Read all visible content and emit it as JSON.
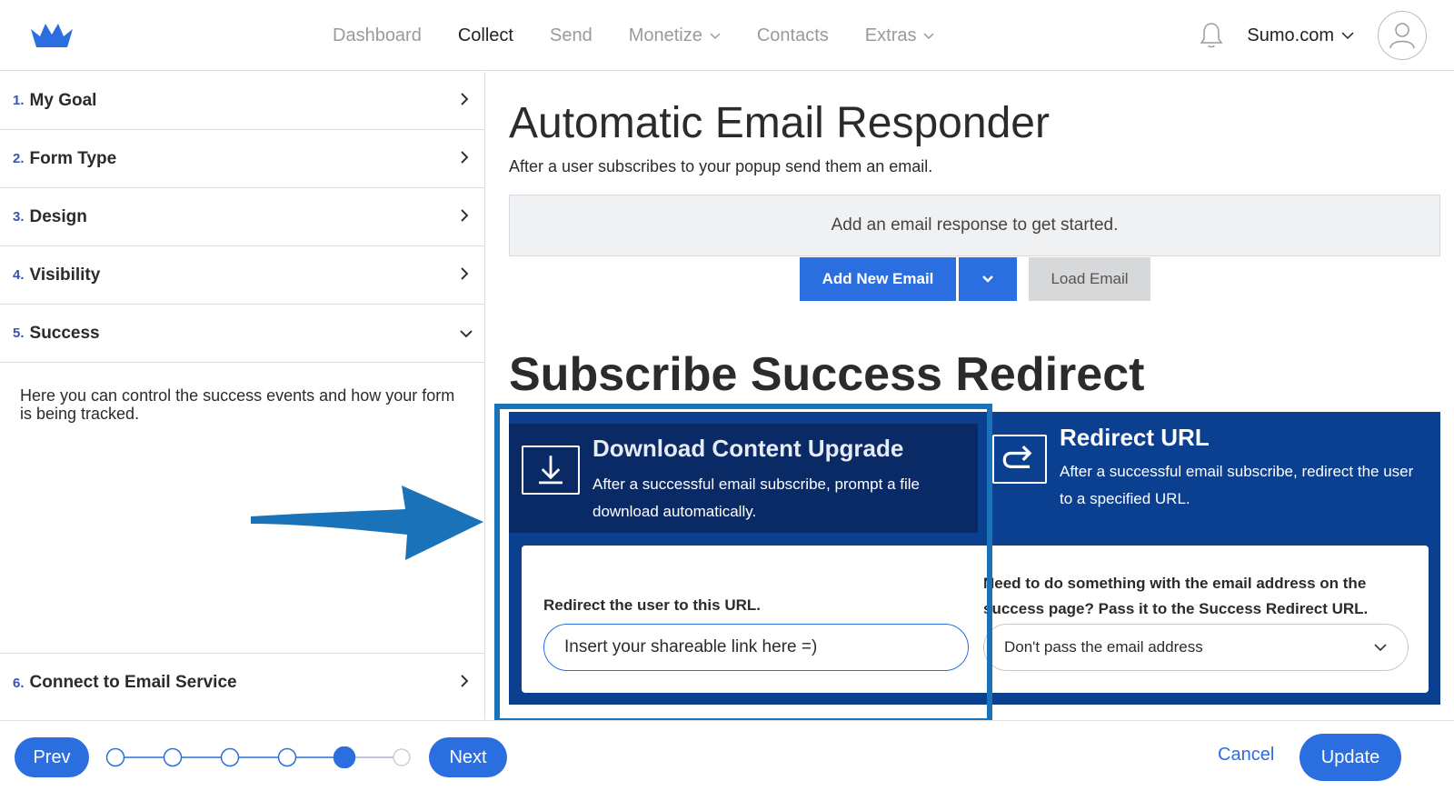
{
  "header": {
    "nav": [
      {
        "label": "Dashboard",
        "active": false,
        "dropdown": false
      },
      {
        "label": "Collect",
        "active": true,
        "dropdown": false
      },
      {
        "label": "Send",
        "active": false,
        "dropdown": false
      },
      {
        "label": "Monetize",
        "active": false,
        "dropdown": true
      },
      {
        "label": "Contacts",
        "active": false,
        "dropdown": false
      },
      {
        "label": "Extras",
        "active": false,
        "dropdown": true
      }
    ],
    "account": "Sumo.com",
    "icons": {
      "logo": "crown-logo",
      "bell": "bell-icon",
      "avatar": "user-avatar-icon"
    }
  },
  "sidebar": {
    "steps": [
      {
        "num": "1.",
        "label": "My Goal"
      },
      {
        "num": "2.",
        "label": "Form Type"
      },
      {
        "num": "3.",
        "label": "Design"
      },
      {
        "num": "4.",
        "label": "Visibility"
      },
      {
        "num": "5.",
        "label": "Success"
      },
      {
        "num": "6.",
        "label": "Connect to Email Service"
      }
    ],
    "success_desc": "Here you can control the success events and how your form is being tracked."
  },
  "responder": {
    "title": "Automatic Email Responder",
    "subtitle": "After a user subscribes to your popup send them an email.",
    "empty": "Add an email response to get started.",
    "add_button": "Add New Email",
    "load_button": "Load Email"
  },
  "redirect": {
    "title": "Subscribe Success Redirect",
    "download": {
      "title": "Download Content Upgrade",
      "desc": "After a successful email subscribe, prompt a file download automatically."
    },
    "url": {
      "title": "Redirect URL",
      "desc": "After a successful email subscribe, redirect the user to a specified URL."
    },
    "field_label": "Redirect the user to this URL.",
    "url_placeholder": "Insert your shareable link here =)",
    "pass_label": "Need to do something with the email address on the success page? Pass it to the Success Redirect URL.",
    "pass_selected": "Don't pass the email address"
  },
  "footer": {
    "prev": "Prev",
    "next": "Next",
    "cancel": "Cancel",
    "update": "Update",
    "current_step": 5,
    "total_steps": 6
  },
  "colors": {
    "primary": "#2b6ee0",
    "dark_blue": "#0a2a66",
    "panel_blue": "#0b3f8f",
    "highlight": "#1a72b8"
  }
}
